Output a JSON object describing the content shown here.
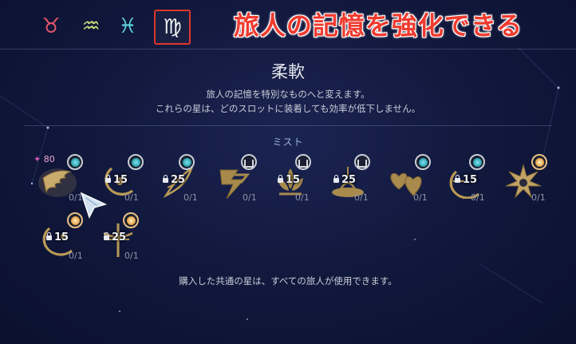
{
  "zodiac_tabs": [
    {
      "symbol": "♉",
      "color": "#e4576a",
      "selected": false
    },
    {
      "symbol": "♒",
      "color": "#c7db7c",
      "selected": false
    },
    {
      "symbol": "♓",
      "color": "#5fd1dd",
      "selected": false
    },
    {
      "symbol": "♍",
      "color": "#f2f2f2",
      "selected": true
    }
  ],
  "headline": "旅人の記憶を強化できる",
  "title": "柔軟",
  "description": [
    "旅人の記憶を特別なものへと変えます。",
    "これらの星は、どのスロットに装着しても効率が低下しません。"
  ],
  "section_label": "ミスト",
  "energy": {
    "icon": "flame-icon",
    "value": "80",
    "color": "#d458b5"
  },
  "stars": [
    {
      "emblem": "wing-emblem-icon",
      "badge": "teal",
      "cost": "",
      "progress": "0/1",
      "unlocked": true
    },
    {
      "emblem": "crescent-emblem-icon",
      "badge": "teal",
      "cost": "15",
      "progress": "0/1",
      "unlocked": false
    },
    {
      "emblem": "feather-emblem-icon",
      "badge": "teal",
      "cost": "25",
      "progress": "0/1",
      "unlocked": false
    },
    {
      "emblem": "lightning-emblem-icon",
      "badge": "lock",
      "cost": "",
      "progress": "0/1",
      "unlocked": false
    },
    {
      "emblem": "lotus-emblem-icon",
      "badge": "lock",
      "cost": "15",
      "progress": "0/1",
      "unlocked": false
    },
    {
      "emblem": "lamp-emblem-icon",
      "badge": "lock",
      "cost": "25",
      "progress": "0/1",
      "unlocked": false
    },
    {
      "emblem": "hearts-emblem-icon",
      "badge": "teal",
      "cost": "",
      "progress": "0/1",
      "unlocked": false
    },
    {
      "emblem": "ring-emblem-icon",
      "badge": "teal",
      "cost": "15",
      "progress": "0/1",
      "unlocked": false
    },
    {
      "emblem": "burst-emblem-icon",
      "badge": "gold",
      "cost": "",
      "progress": "0/1",
      "unlocked": false
    },
    {
      "emblem": "orb-emblem-icon",
      "badge": "gold",
      "cost": "15",
      "progress": "0/1",
      "unlocked": false
    },
    {
      "emblem": "cross-emblem-icon",
      "badge": "gold",
      "cost": "25",
      "progress": "0/1",
      "unlocked": false
    }
  ],
  "footer": "購入した共通の星は、すべての旅人が使用できます。",
  "colors": {
    "accent_red": "#e0352b",
    "emblem_gold": "#b99a56",
    "background": "#10173a"
  }
}
